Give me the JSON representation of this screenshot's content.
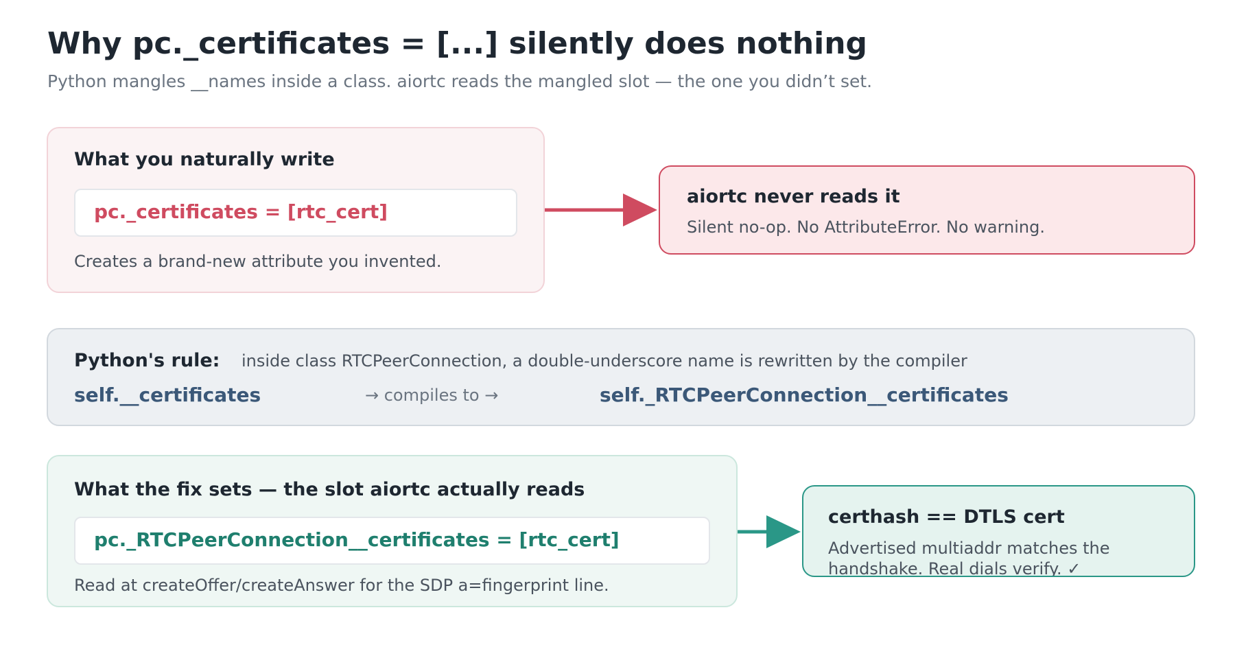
{
  "header": {
    "title": "Why pc._certificates = [...] silently does nothing",
    "subtitle": "Python mangles __names inside a class. aiortc reads the mangled slot — the one you didn’t set."
  },
  "wrong": {
    "heading": "What you naturally write",
    "code": "pc._certificates = [rtc_cert]",
    "note": "Creates a brand-new attribute you invented."
  },
  "wrong_result": {
    "heading": "aiortc never reads it",
    "text": "Silent no-op. No AttributeError. No warning."
  },
  "rule": {
    "label": "Python's rule:",
    "text": "inside class RTCPeerConnection, a double-underscore name is rewritten by the compiler",
    "source": "self.__certificates",
    "arrow_text": "→ compiles to →",
    "target": "self._RTCPeerConnection__certificates"
  },
  "fix": {
    "heading": "What the fix sets — the slot aiortc actually reads",
    "code": "pc._RTCPeerConnection__certificates = [rtc_cert]",
    "note": "Read at createOffer/createAnswer for the SDP a=fingerprint line."
  },
  "fix_result": {
    "heading": "certhash == DTLS cert",
    "line1": "Advertised multiaddr matches the",
    "line2": "handshake. Real dials verify. ✓"
  },
  "colors": {
    "wrong_accent": "#cf4b60",
    "fix_accent": "#2a9787",
    "rule_code": "#3b5878"
  }
}
